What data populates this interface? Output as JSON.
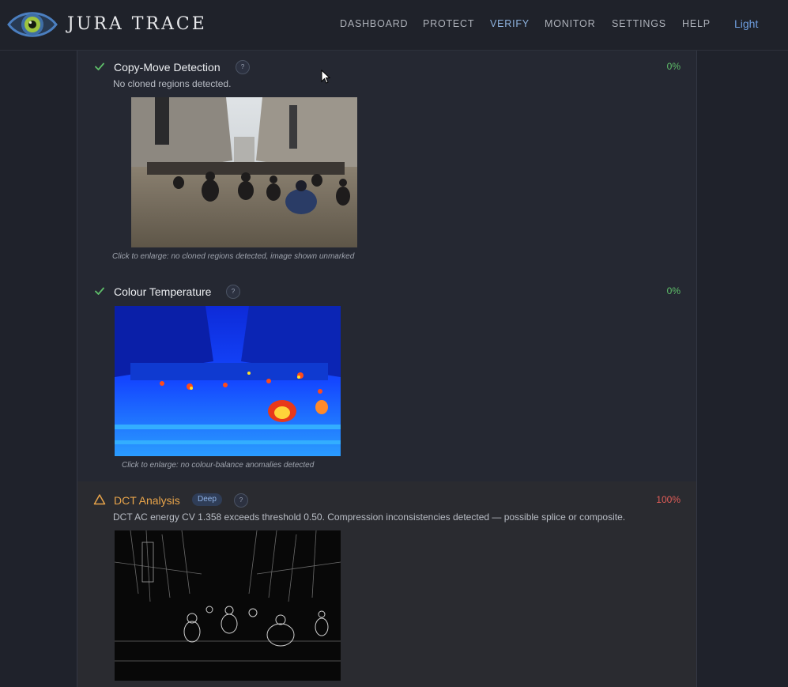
{
  "app": {
    "brand": "JURA TRACE"
  },
  "nav": {
    "items": [
      "DASHBOARD",
      "PROTECT",
      "VERIFY",
      "MONITOR",
      "SETTINGS",
      "HELP"
    ],
    "active": "VERIFY",
    "theme_toggle": "Light"
  },
  "colors": {
    "ok": "#5fbf6a",
    "warn": "#e8a44a",
    "bad": "#e25d58",
    "accent": "#8fb4e0"
  },
  "checks": [
    {
      "title": "Copy-Move Detection",
      "status": "pass",
      "status_icon": "check-icon",
      "percent": "0%",
      "description": "No cloned regions detected.",
      "caption": "Click to enlarge: no cloned regions detected, image shown unmarked",
      "help": "?"
    },
    {
      "title": "Colour Temperature",
      "status": "pass",
      "status_icon": "check-icon",
      "percent": "0%",
      "description": "",
      "caption": "Click to enlarge: no colour-balance anomalies detected",
      "help": "?"
    },
    {
      "title": "DCT Analysis",
      "status": "warning",
      "status_icon": "warning-triangle-icon",
      "badge": "Deep",
      "percent": "100%",
      "description": "DCT AC energy CV 1.358 exceeds threshold 0.50. Compression inconsistencies detected — possible splice or composite.",
      "help": "?"
    }
  ]
}
